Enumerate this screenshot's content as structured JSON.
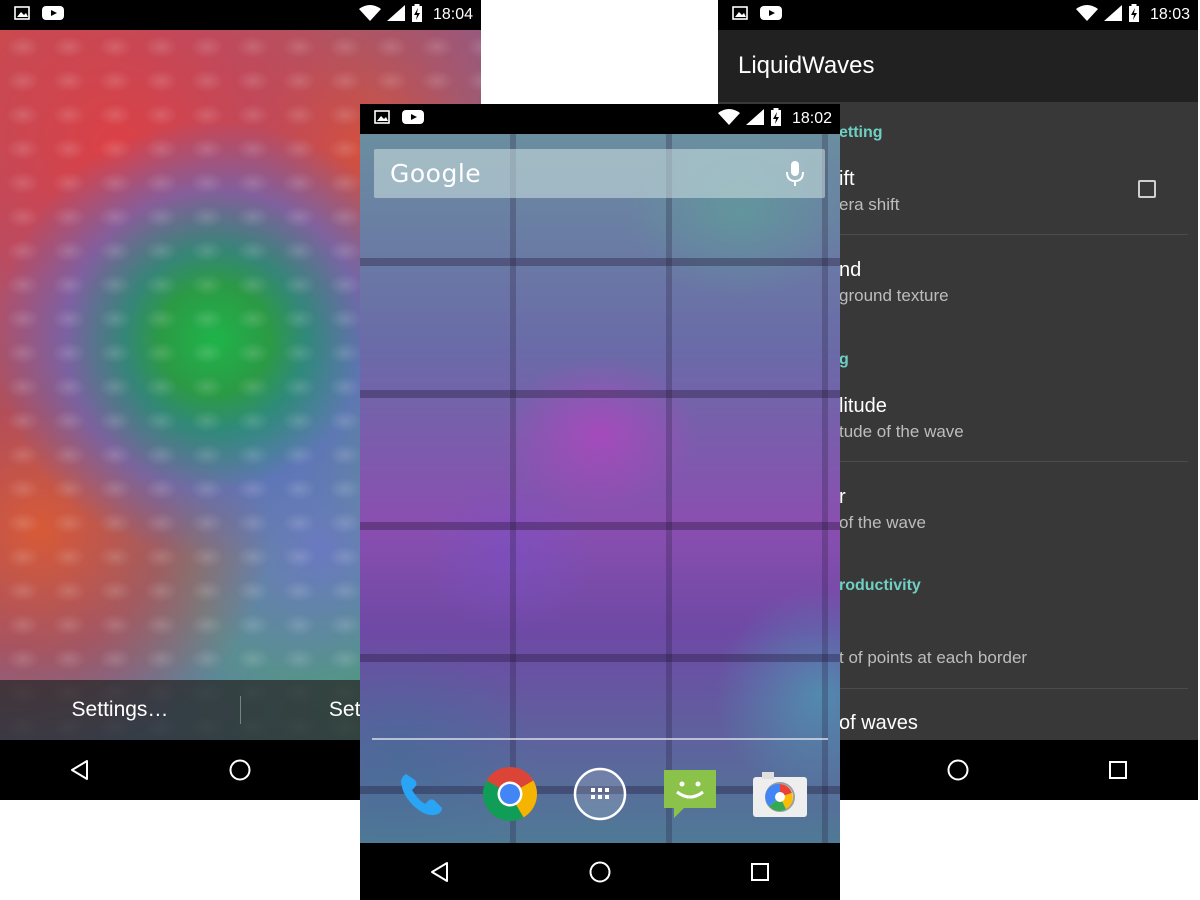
{
  "phone_left": {
    "status_time": "18:04",
    "bottom_actions": [
      "Settings…",
      "Set wa"
    ]
  },
  "phone_center": {
    "status_time": "18:02",
    "search": {
      "label": "Google"
    },
    "dock": [
      {
        "name": "phone-icon"
      },
      {
        "name": "chrome-icon"
      },
      {
        "name": "app-drawer-icon"
      },
      {
        "name": "messaging-icon"
      },
      {
        "name": "camera-icon"
      }
    ]
  },
  "phone_right": {
    "status_time": "18:03",
    "app_title": "LiquidWaves",
    "categories": [
      "etting",
      "g",
      "roductivity"
    ],
    "prefs": [
      {
        "title": "ift",
        "summary": "era shift",
        "checked": false
      },
      {
        "title": "nd",
        "summary": "ground texture"
      },
      {
        "title": "litude",
        "summary": "tude of the wave"
      },
      {
        "title": "r",
        "summary": "of the wave"
      },
      {
        "title": "",
        "summary": "t of points at each border"
      },
      {
        "title": "of waves",
        "summary": ""
      }
    ]
  },
  "colors": {
    "accent": "#6fcfc2",
    "status_bar": "#000000",
    "app_bar": "#212121",
    "settings_bg": "#383838"
  }
}
